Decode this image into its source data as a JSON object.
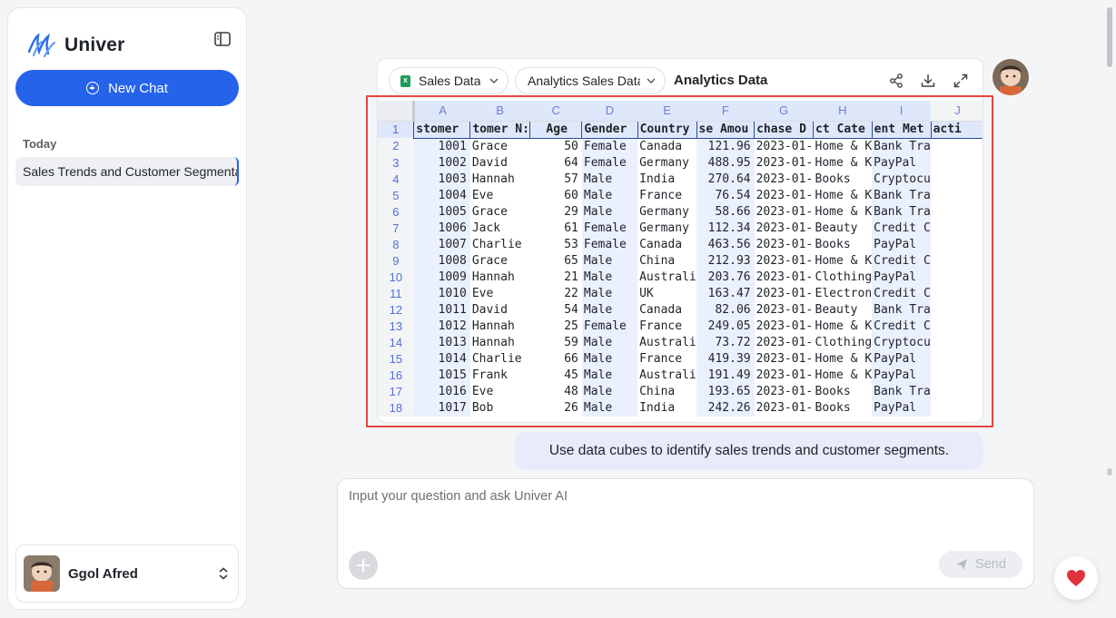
{
  "brand": {
    "name": "Univer"
  },
  "sidebar": {
    "new_chat_label": "New Chat",
    "section_label": "Today",
    "history": [
      {
        "label": "Sales Trends and Customer Segmentation"
      }
    ],
    "user": {
      "name": "Ggol Afred"
    }
  },
  "sheet_toolbar": {
    "sheet_select": "Sales Data",
    "table_select": "Analytics Sales Data",
    "title": "Analytics Data"
  },
  "grid": {
    "columns": [
      "A",
      "B",
      "C",
      "D",
      "E",
      "F",
      "G",
      "H",
      "I",
      "J"
    ],
    "header_row": [
      "stomer",
      "tomer N:",
      "Age",
      "Gender",
      "Country",
      "se Amou",
      "chase D",
      "ct Cate",
      "ent Met",
      "acti"
    ],
    "rows": [
      [
        "2",
        "1001",
        "Grace",
        "50",
        "Female",
        "Canada",
        "121.96",
        "2023-01-",
        "Home & K",
        "Bank Tra"
      ],
      [
        "3",
        "1002",
        "David",
        "64",
        "Female",
        "Germany",
        "488.95",
        "2023-01-",
        "Home & K",
        "PayPal"
      ],
      [
        "4",
        "1003",
        "Hannah",
        "57",
        "Male",
        "India",
        "270.64",
        "2023-01-",
        "Books",
        "Cryptocu"
      ],
      [
        "5",
        "1004",
        "Eve",
        "60",
        "Male",
        "France",
        "76.54",
        "2023-01-",
        "Home & K",
        "Bank Tra"
      ],
      [
        "6",
        "1005",
        "Grace",
        "29",
        "Male",
        "Germany",
        "58.66",
        "2023-01-",
        "Home & K",
        "Bank Tra"
      ],
      [
        "7",
        "1006",
        "Jack",
        "61",
        "Female",
        "Germany",
        "112.34",
        "2023-01-",
        "Beauty",
        "Credit C"
      ],
      [
        "8",
        "1007",
        "Charlie",
        "53",
        "Female",
        "Canada",
        "463.56",
        "2023-01-",
        "Books",
        "PayPal"
      ],
      [
        "9",
        "1008",
        "Grace",
        "65",
        "Male",
        "China",
        "212.93",
        "2023-01-",
        "Home & K",
        "Credit C"
      ],
      [
        "10",
        "1009",
        "Hannah",
        "21",
        "Male",
        "Australi",
        "203.76",
        "2023-01-",
        "Clothing",
        "PayPal"
      ],
      [
        "11",
        "1010",
        "Eve",
        "22",
        "Male",
        "UK",
        "163.47",
        "2023-01-",
        "Electron",
        "Credit C"
      ],
      [
        "12",
        "1011",
        "David",
        "54",
        "Male",
        "Canada",
        "82.06",
        "2023-01-",
        "Beauty",
        "Bank Tra"
      ],
      [
        "13",
        "1012",
        "Hannah",
        "25",
        "Female",
        "France",
        "249.05",
        "2023-01-",
        "Home & K",
        "Credit C"
      ],
      [
        "14",
        "1013",
        "Hannah",
        "59",
        "Male",
        "Australi",
        "73.72",
        "2023-01-",
        "Clothing",
        "Cryptocu"
      ],
      [
        "15",
        "1014",
        "Charlie",
        "66",
        "Male",
        "France",
        "419.39",
        "2023-01-",
        "Home & K",
        "PayPal"
      ],
      [
        "16",
        "1015",
        "Frank",
        "45",
        "Male",
        "Australi",
        "191.49",
        "2023-01-",
        "Home & K",
        "PayPal"
      ],
      [
        "17",
        "1016",
        "Eve",
        "48",
        "Male",
        "China",
        "193.65",
        "2023-01-",
        "Books",
        "Bank Tra"
      ],
      [
        "18",
        "1017",
        "Bob",
        "26",
        "Male",
        "India",
        "242.26",
        "2023-01-",
        "Books",
        "PayPal"
      ]
    ]
  },
  "message": {
    "text": "Use data cubes to identify sales trends and customer segments."
  },
  "composer": {
    "placeholder": "Input your question and ask Univer AI",
    "send_label": "Send"
  },
  "colors": {
    "accent": "#2563eb",
    "selection_outline": "#e0483e",
    "bubble": "#e9ebfb",
    "favorite": "#e0323c"
  }
}
